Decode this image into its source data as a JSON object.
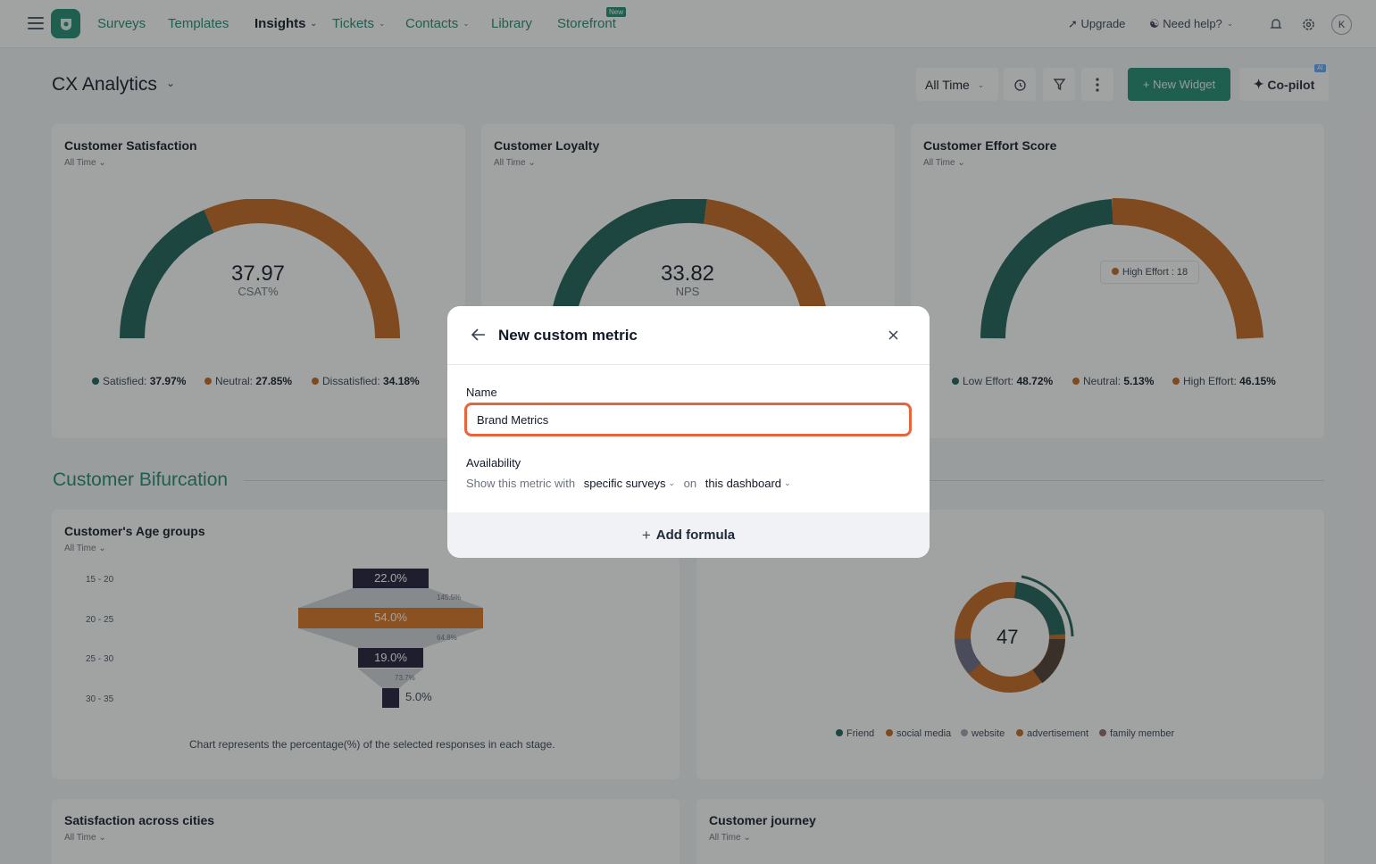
{
  "nav": {
    "items": [
      {
        "label": "Surveys"
      },
      {
        "label": "Templates"
      },
      {
        "label": "Insights"
      },
      {
        "label": "Tickets"
      },
      {
        "label": "Contacts"
      },
      {
        "label": "Library"
      },
      {
        "label": "Storefront"
      }
    ],
    "new_badge": "New",
    "upgrade": "Upgrade",
    "help": "Need help?",
    "avatar": "K"
  },
  "header": {
    "title": "CX Analytics",
    "time_filter": "All Time",
    "new_widget": "New Widget",
    "copilot": "Co-pilot",
    "ai_badge": "AI"
  },
  "cards": {
    "csat": {
      "title": "Customer Satisfaction",
      "period": "All Time",
      "value": "37.97",
      "label": "CSAT%",
      "legend": [
        {
          "name": "Satisfied:",
          "value": "37.97%",
          "color": "#1e5f57"
        },
        {
          "name": "Neutral:",
          "value": "27.85%",
          "color": "#c4661f"
        },
        {
          "name": "Dissatisfied:",
          "value": "34.18%",
          "color": "#c4661f"
        }
      ]
    },
    "loyalty": {
      "title": "Customer Loyalty",
      "period": "All Time",
      "value": "33.82",
      "label": "NPS"
    },
    "effort": {
      "title": "Customer Effort Score",
      "period": "All Time",
      "tooltip": "High Effort : 18",
      "legend": [
        {
          "name": "Low Effort:",
          "value": "48.72%",
          "color": "#1e5f57"
        },
        {
          "name": "Neutral:",
          "value": "5.13%",
          "color": "#c4661f"
        },
        {
          "name": "High Effort:",
          "value": "46.15%",
          "color": "#c4661f"
        }
      ]
    }
  },
  "section": {
    "title": "Customer Bifurcation"
  },
  "age": {
    "title": "Customer's Age groups",
    "period": "All Time",
    "labels": [
      "15 - 20",
      "20 - 25",
      "25 - 30",
      "30 - 35"
    ],
    "values": [
      "22.0%",
      "54.0%",
      "19.0%",
      "5.0%"
    ],
    "drops": [
      "145.5%",
      "64.8%",
      "73.7%"
    ],
    "note": "Chart represents the percentage(%) of the selected responses in each stage."
  },
  "donut": {
    "value": "47",
    "legend": [
      "Friend",
      "social media",
      "website",
      "advertisement",
      "family member"
    ]
  },
  "bottom": {
    "cities": {
      "title": "Satisfaction across cities",
      "period": "All Time"
    },
    "journey": {
      "title": "Customer journey",
      "period": "All Time"
    }
  },
  "modal": {
    "title": "New custom metric",
    "name_label": "Name",
    "name_value": "Brand Metrics",
    "availability_label": "Availability",
    "availability_prefix": "Show this metric with",
    "availability_scope": "specific surveys",
    "availability_on": "on",
    "availability_target": "this dashboard",
    "add_formula": "Add formula"
  }
}
